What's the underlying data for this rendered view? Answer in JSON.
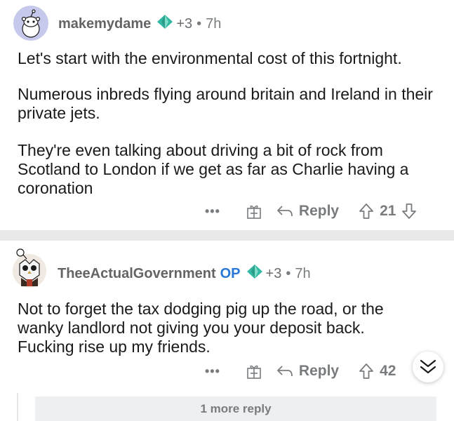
{
  "comments": [
    {
      "username": "makemydame",
      "op_badge": "",
      "awards_count": "+3",
      "time": "7h",
      "paragraphs": [
        "Let's start with the environmental cost of this fortnight.",
        "Numerous inbreds flying around britain and Ireland in their private jets.",
        "They're even talking about driving a bit of rock from Scotland to London if we get as far as Charlie having a coronation"
      ],
      "more_label": "•••",
      "reply_label": "Reply",
      "vote_count": "21"
    },
    {
      "username": "TheeActualGovernment",
      "op_badge": "OP",
      "awards_count": "+3",
      "time": "7h",
      "paragraphs": [
        "Not to forget the tax dodging pig up the road, or the wanky landlord not giving you your deposit back. Fucking rise up my friends."
      ],
      "more_label": "•••",
      "reply_label": "Reply",
      "vote_count": "42"
    }
  ],
  "more_replies_label": "1 more reply",
  "colors": {
    "meta_text": "#787c7e",
    "op_blue": "#2a78d6",
    "award_teal": "#33b8a3",
    "separator": "#e9e9ea"
  }
}
